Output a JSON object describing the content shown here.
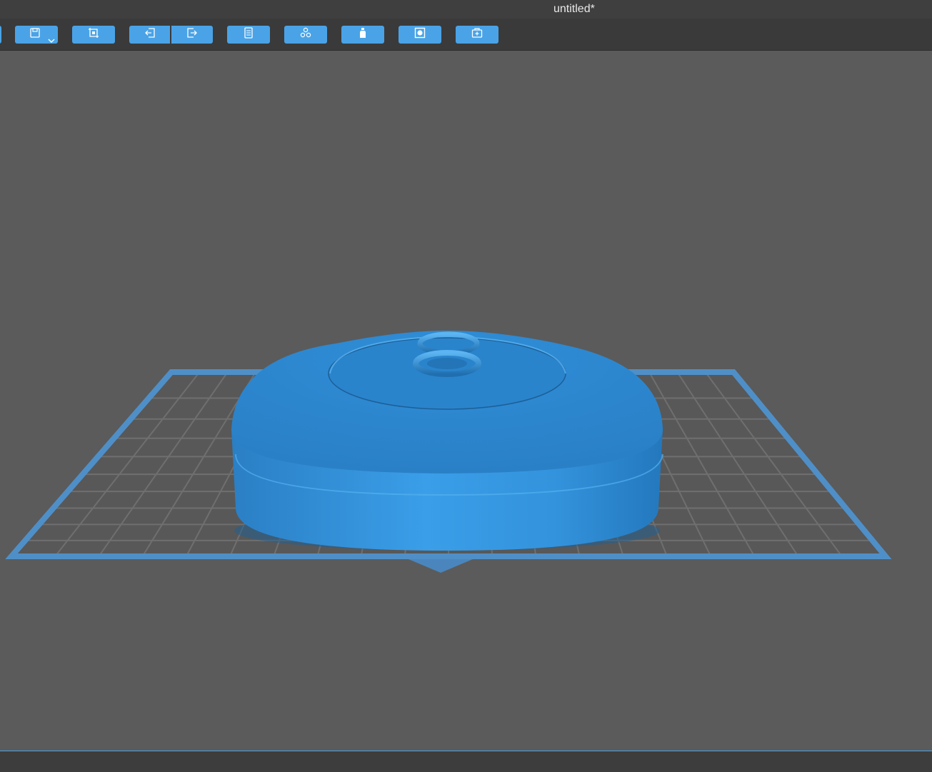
{
  "window": {
    "title": "untitled*"
  },
  "toolbar": {
    "buttons": [
      {
        "name": "open-button",
        "icon": "folder-icon"
      },
      {
        "name": "save-button",
        "icon": "floppy-icon",
        "has_dropdown": true
      },
      {
        "name": "fit-view-button",
        "icon": "frame-icon"
      },
      {
        "name": "import-button",
        "icon": "arrow-in-icon"
      },
      {
        "name": "export-button",
        "icon": "arrow-out-icon"
      },
      {
        "name": "object-list-button",
        "icon": "list-icon"
      },
      {
        "name": "arrange-button",
        "icon": "molecules-icon"
      },
      {
        "name": "support-button",
        "icon": "bottle-icon"
      },
      {
        "name": "slice-preview-button",
        "icon": "square-dot-icon"
      },
      {
        "name": "add-object-button",
        "icon": "box-plus-icon"
      }
    ]
  },
  "colors": {
    "accent": "#4aa3e6",
    "model": "#2f8ed8",
    "viewport": "#5b5b5b",
    "grid_line": "#6e6e6e",
    "plate_border": "#4f8fc8"
  }
}
